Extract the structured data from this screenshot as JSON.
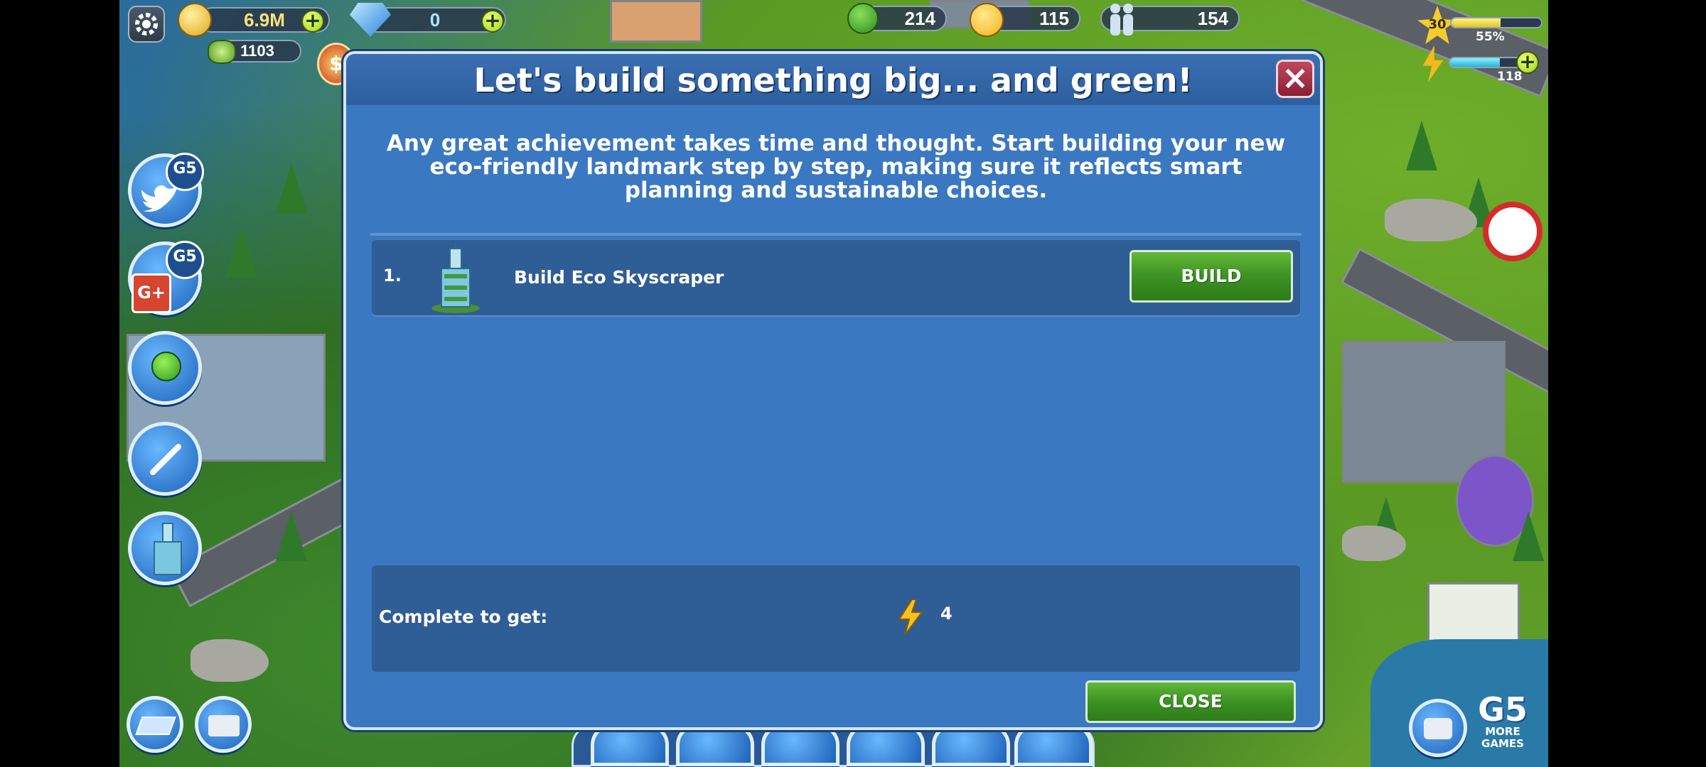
{
  "hud": {
    "coins": "6.9M",
    "cash": "1103",
    "gems": "0",
    "eco": "214",
    "happiness": "115",
    "population": "154",
    "level": "30",
    "xp_percent_label": "55%",
    "xp_fraction": 0.55,
    "energy": "118",
    "energy_fraction": 0.7
  },
  "dialog": {
    "title": "Let's build something big... and green!",
    "description": "Any great achievement takes time and thought. Start building your new eco-friendly landmark step by step, making sure it reflects smart planning and sustainable choices.",
    "tasks": [
      {
        "number": "1.",
        "label": "Build Eco Skyscraper",
        "button": "BUILD"
      }
    ],
    "reward_label": "Complete to get:",
    "reward_value": "4",
    "close_button": "CLOSE"
  },
  "brand": {
    "more_games_line1": "MORE",
    "more_games_line2": "GAMES",
    "g5": "G5",
    "g5_games": "GAMES"
  },
  "colors": {
    "dialog_bg": "#3a78c1",
    "panel_bg": "#2f5d96",
    "button_green": "#3c9223",
    "close_red": "#8b1f33"
  }
}
